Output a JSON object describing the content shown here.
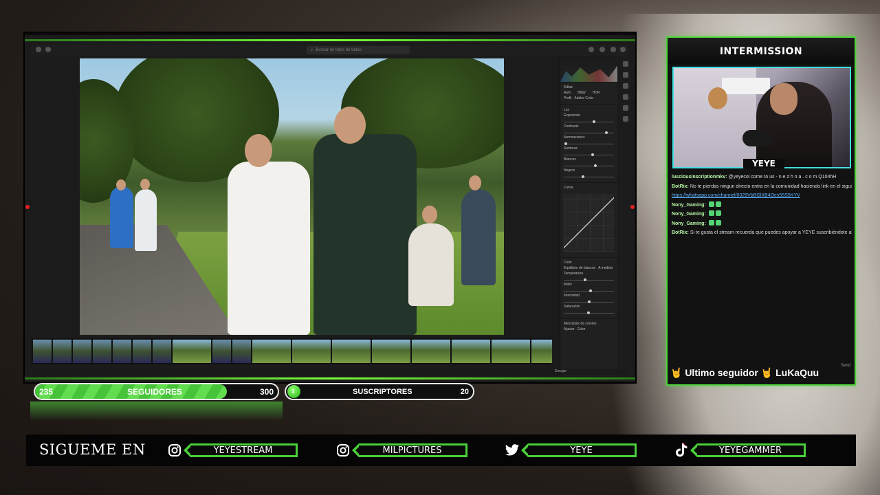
{
  "lightroom": {
    "search_placeholder": "Buscar en fotos de todas",
    "panel": {
      "editor_label": "Editar",
      "auto_label": "Auto",
      "bw_label": "B&W",
      "hdr_label": "HDR",
      "profile_label": "Perfil",
      "profile_value": "Adobe Color",
      "light_label": "Luz",
      "sliders": [
        "Exposición",
        "Contraste",
        "Iluminaciones",
        "Sombras",
        "Blancos",
        "Negros"
      ],
      "curve_label": "Curva",
      "color_label": "Color",
      "wb_label": "Equilibrio de blancos",
      "wb_value": "A medida",
      "color_sliders": [
        "Temperatura",
        "Matiz",
        "Intensidad",
        "Saturación"
      ],
      "mixer_label": "Mezclador de colores",
      "adjust_label": "Ajustar",
      "adjust_value": "Color"
    },
    "bottom": {
      "fit_label": "Encajar"
    }
  },
  "stats": {
    "followers": {
      "current": "235",
      "label": "SEGUIDORES",
      "goal": "300",
      "progress_fraction": 0.79
    },
    "subscribers": {
      "current": "1",
      "label": "SUSCRIPTORES",
      "goal": "20"
    }
  },
  "stream_panel": {
    "title": "INTERMISSION",
    "cam_name": "YEYE",
    "chat": [
      {
        "user": "lusciousinscriptionmkv:",
        "text": "@yeyecol come to us - n e z h n a . c o m Q104hH"
      },
      {
        "user": "BotRix:",
        "text": "No te pierdas ningun directo entra en la comunidad haciendo link en el siguiente link"
      },
      {
        "user": "",
        "text": "https://whatsapp.com/channel/0029VbBGlXB4Oes55S5KYV",
        "link": true
      },
      {
        "user": "Nony_Gaming:",
        "text": ""
      },
      {
        "user": "Nony_Gaming:",
        "text": ""
      },
      {
        "user": "Nony_Gaming:",
        "text": ""
      },
      {
        "user": "BotRix:",
        "text": "Si te gusta el stream recuerda que puedes apoyar a YEYE suscribiéndote al canal"
      }
    ],
    "last_follower_label": "🤘 Ultimo seguidor 🤘 LuKaQuu",
    "send_label": "Send"
  },
  "social": {
    "heading": "SIGUEME EN",
    "items": [
      {
        "icon": "instagram-icon",
        "handle": "YEYESTREAM"
      },
      {
        "icon": "instagram-icon",
        "handle": "MILPICTURES"
      },
      {
        "icon": "twitter-icon",
        "handle": "YEYE"
      },
      {
        "icon": "tiktok-icon",
        "handle": "YEYEGAMMER"
      }
    ]
  },
  "colors": {
    "accent_green": "#4ad03a",
    "cam_border": "#3fe0e0",
    "bar_fill": "#47c33a"
  }
}
